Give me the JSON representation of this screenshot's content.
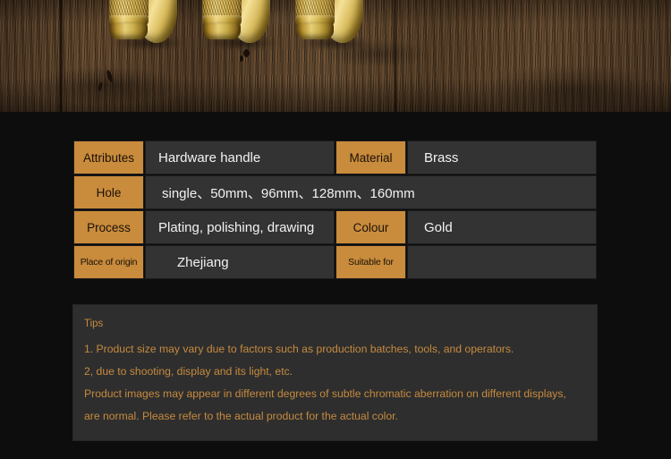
{
  "hero": {
    "alt": "brass cabinet knobs on dark wood surface",
    "product": "gold knurled brass handle knobs"
  },
  "spec_table": {
    "rows": [
      {
        "label_a": "Attributes",
        "value_a": "Hardware handle",
        "label_b": "Material",
        "value_b": "Brass"
      },
      {
        "label_a": "Hole",
        "value_a": "single、50mm、96mm、128mm、160mm",
        "label_b": "",
        "value_b": ""
      },
      {
        "label_a": "Process",
        "value_a": "Plating, polishing, drawing",
        "label_b": "Colour",
        "value_b": "Gold"
      },
      {
        "label_a": "Place of origin",
        "value_a": "Zhejiang",
        "label_b": "Suitable for",
        "value_b": ""
      }
    ]
  },
  "tips": {
    "title": "Tips",
    "lines": [
      "1. Product size may vary due to factors such as production batches, tools, and operators.",
      "2, due to shooting, display and its light, etc.",
      "Product images may appear in different degrees of subtle chromatic aberration on different displays,",
      "are normal. Please refer to the actual product for the actual color."
    ]
  },
  "colors": {
    "accent_orange": "#c98b3c",
    "cell_bg": "#333333",
    "page_bg": "#0d0d0d",
    "tips_bg": "#2e2e2e",
    "tips_text": "#c68a3f",
    "value_text": "#f2f2f2"
  }
}
